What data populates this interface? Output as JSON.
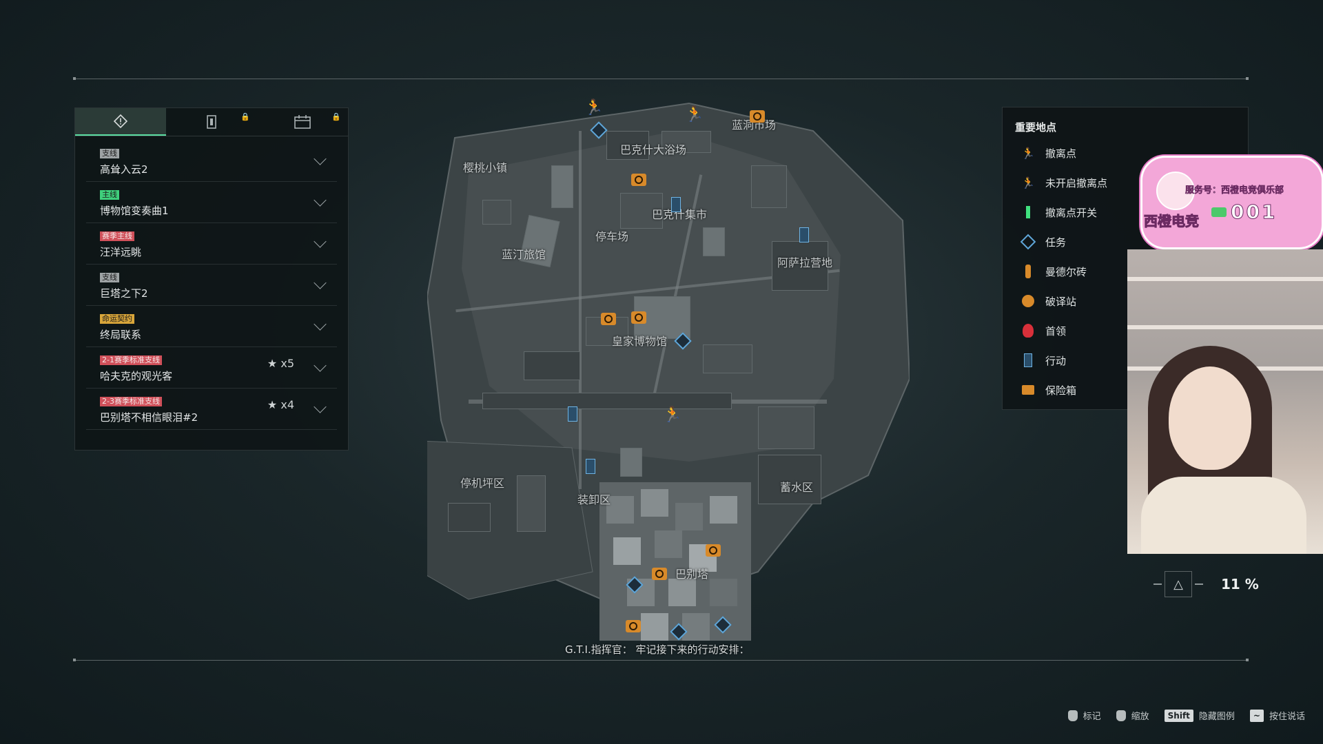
{
  "quest_panel": {
    "tabs": [
      {
        "icon": "quest-diamond-icon",
        "active": true
      },
      {
        "icon": "action-card-icon",
        "locked": true
      },
      {
        "icon": "calendar-icon",
        "locked": true
      }
    ],
    "quests": [
      {
        "tag": "支线",
        "tag_color": "#9ea3a5",
        "name": "高耸入云2"
      },
      {
        "tag": "主线",
        "tag_color": "#3fd07c",
        "name": "博物馆变奏曲1"
      },
      {
        "tag": "赛季主线",
        "tag_color": "#d0505a",
        "name": "汪洋远眺"
      },
      {
        "tag": "支线",
        "tag_color": "#9ea3a5",
        "name": "巨塔之下2"
      },
      {
        "tag": "命运契约",
        "tag_color": "#d9a63a",
        "name": "终局联系"
      },
      {
        "tag": "2-1赛季标准支线",
        "tag_color": "#d0505a",
        "name": "哈夫克的观光客",
        "stars": "★ x5"
      },
      {
        "tag": "2-3赛季标准支线",
        "tag_color": "#d0505a",
        "name": "巴别塔不相信眼泪#2",
        "stars": "★ x4"
      }
    ]
  },
  "map": {
    "labels": {
      "town": "樱桃小镇",
      "bath": "巴克什大浴场",
      "cond": "蓝洞市场",
      "market": "巴克什集市",
      "parking": "停车场",
      "hotel": "蓝汀旅馆",
      "camp": "阿萨拉营地",
      "museum": "皇家博物馆",
      "heliport": "停机坪区",
      "loading": "装卸区",
      "reservoir": "蓄水区",
      "tower": "巴别塔"
    }
  },
  "legend": {
    "title": "重要地点",
    "items": [
      {
        "icon": "extraction-icon",
        "label": "撤离点",
        "color": "#40e07e"
      },
      {
        "icon": "inactive-extraction-icon",
        "label": "未开启撤离点",
        "color": "#9aa2a4"
      },
      {
        "icon": "extraction-switch-icon",
        "label": "撤离点开关",
        "color": "#40e07e"
      },
      {
        "icon": "task-icon",
        "label": "任务",
        "color": "#5fa6d8"
      },
      {
        "icon": "mandel-brick-icon",
        "label": "曼德尔砖",
        "color": "#d88a2a"
      },
      {
        "icon": "decoder-icon",
        "label": "破译站",
        "color": "#d88a2a"
      },
      {
        "icon": "boss-icon",
        "label": "首领",
        "color": "#d8303a"
      },
      {
        "icon": "action-icon",
        "label": "行动",
        "color": "#5fa6d8"
      },
      {
        "icon": "safe-icon",
        "label": "保险箱",
        "color": "#d88a2a"
      }
    ]
  },
  "overlay": {
    "service": "服务号：西橙电竞俱乐部",
    "name": "西橙电竞",
    "number": "001"
  },
  "zoom": {
    "value": "11 %"
  },
  "dialogue": "G.T.I.指挥官：  牢记接下来的行动安排：",
  "hints": [
    {
      "icon": "mouse-left-icon",
      "label": "标记"
    },
    {
      "icon": "mouse-scroll-icon",
      "label": "缩放"
    },
    {
      "key": "Shift",
      "label": "隐藏图例"
    },
    {
      "key": "~",
      "label": "按住说话"
    }
  ]
}
